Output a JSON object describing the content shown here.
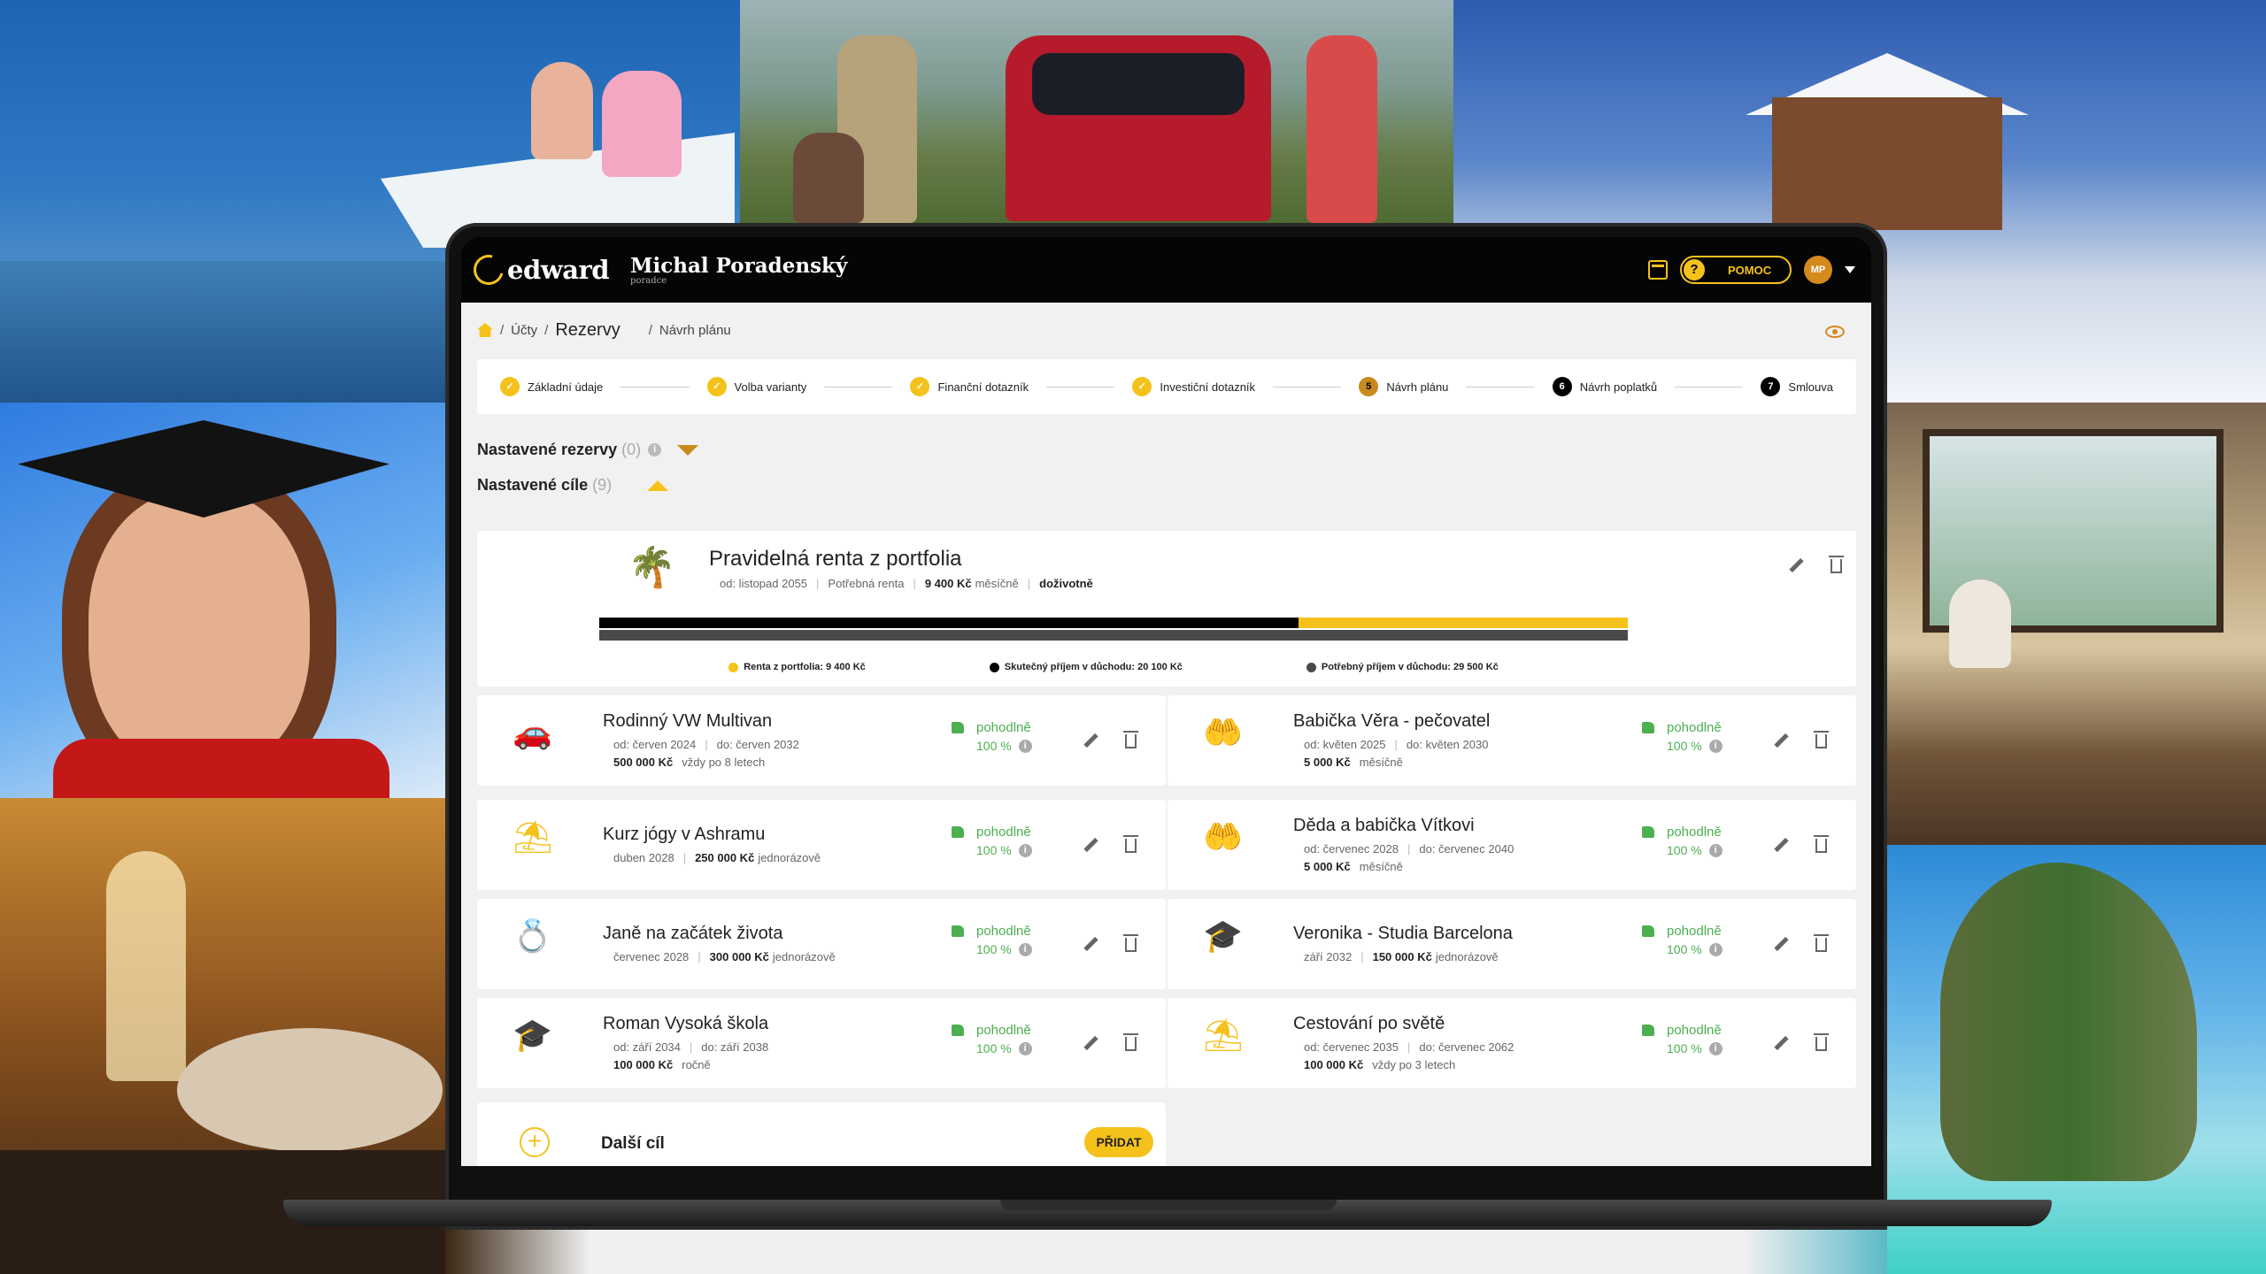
{
  "header": {
    "logo_text": "edward",
    "advisor_name": "Michal Poradenský",
    "advisor_role": "poradce",
    "help_label": "POMOC",
    "user_initials": "MP"
  },
  "breadcrumb": {
    "item1": "Účty",
    "current": "Rezervy",
    "item3": "Návrh plánu"
  },
  "steps": [
    {
      "label": "Základní údaje",
      "state": "done"
    },
    {
      "label": "Volba varianty",
      "state": "done"
    },
    {
      "label": "Finanční dotazník",
      "state": "done"
    },
    {
      "label": "Investiční dotazník",
      "state": "done"
    },
    {
      "label": "Návrh plánu",
      "state": "current",
      "num": "5"
    },
    {
      "label": "Návrh poplatků",
      "state": "todo",
      "num": "6"
    },
    {
      "label": "Smlouva",
      "state": "todo",
      "num": "7"
    }
  ],
  "reserves": {
    "label": "Nastavené rezervy",
    "count": "(0)"
  },
  "goals_section": {
    "label": "Nastavené cíle",
    "count": "(9)"
  },
  "renta": {
    "title": "Pravidelná renta z portfolia",
    "from": "od: listopad 2055",
    "need_label": "Potřebná renta",
    "amount": "9 400 Kč",
    "period": "měsíčně",
    "duration": "doživotně",
    "legend": [
      {
        "label": "Renta z portfolia: 9 400 Kč",
        "color": "#f5c21c"
      },
      {
        "label": "Skutečný příjem v důchodu: 20 100 Kč",
        "color": "#000000"
      },
      {
        "label": "Potřebný příjem v důchodu: 29 500 Kč",
        "color": "#4a4a4a"
      }
    ],
    "progress": {
      "actual_fraction": 0.68,
      "renta_fraction": 0.32
    }
  },
  "goal_status": {
    "label": "pohodlně",
    "percent": "100 %"
  },
  "goals": [
    {
      "title": "Rodinný VW Multivan",
      "icon": "car",
      "l1a": "od: červen 2024",
      "l1b": "do: červen 2032",
      "amount": "500 000 Kč",
      "note": "vždy po 8 letech"
    },
    {
      "title": "Babička Věra - pečovatel",
      "icon": "hands",
      "l1a": "od: květen 2025",
      "l1b": "do: květen 2030",
      "amount": "5 000 Kč",
      "note": "měsíčně"
    },
    {
      "title": "Kurz jógy v Ashramu",
      "icon": "beach",
      "l1a": "duben 2028",
      "l1b": "",
      "amount": "250 000 Kč",
      "note": "jednorázově",
      "inline": true
    },
    {
      "title": "Děda a babička Vítkovi",
      "icon": "hands",
      "l1a": "od: červenec 2028",
      "l1b": "do: červenec 2040",
      "amount": "5 000 Kč",
      "note": "měsíčně"
    },
    {
      "title": "Janě na začátek života",
      "icon": "rings",
      "l1a": "červenec 2028",
      "l1b": "",
      "amount": "300 000 Kč",
      "note": "jednorázově",
      "inline": true
    },
    {
      "title": "Veronika - Studia Barcelona",
      "icon": "grad",
      "l1a": "září 2032",
      "l1b": "",
      "amount": "150 000 Kč",
      "note": "jednorázově",
      "inline": true
    },
    {
      "title": "Roman Vysoká škola",
      "icon": "grad",
      "l1a": "od: září 2034",
      "l1b": "do: září 2038",
      "amount": "100 000 Kč",
      "note": "ročně"
    },
    {
      "title": "Cestování po světě",
      "icon": "beach",
      "l1a": "od: červenec 2035",
      "l1b": "do: červenec 2062",
      "amount": "100 000 Kč",
      "note": "vždy po 3 letech"
    }
  ],
  "add_goal": {
    "label": "Další cíl",
    "button": "PŘIDAT"
  }
}
